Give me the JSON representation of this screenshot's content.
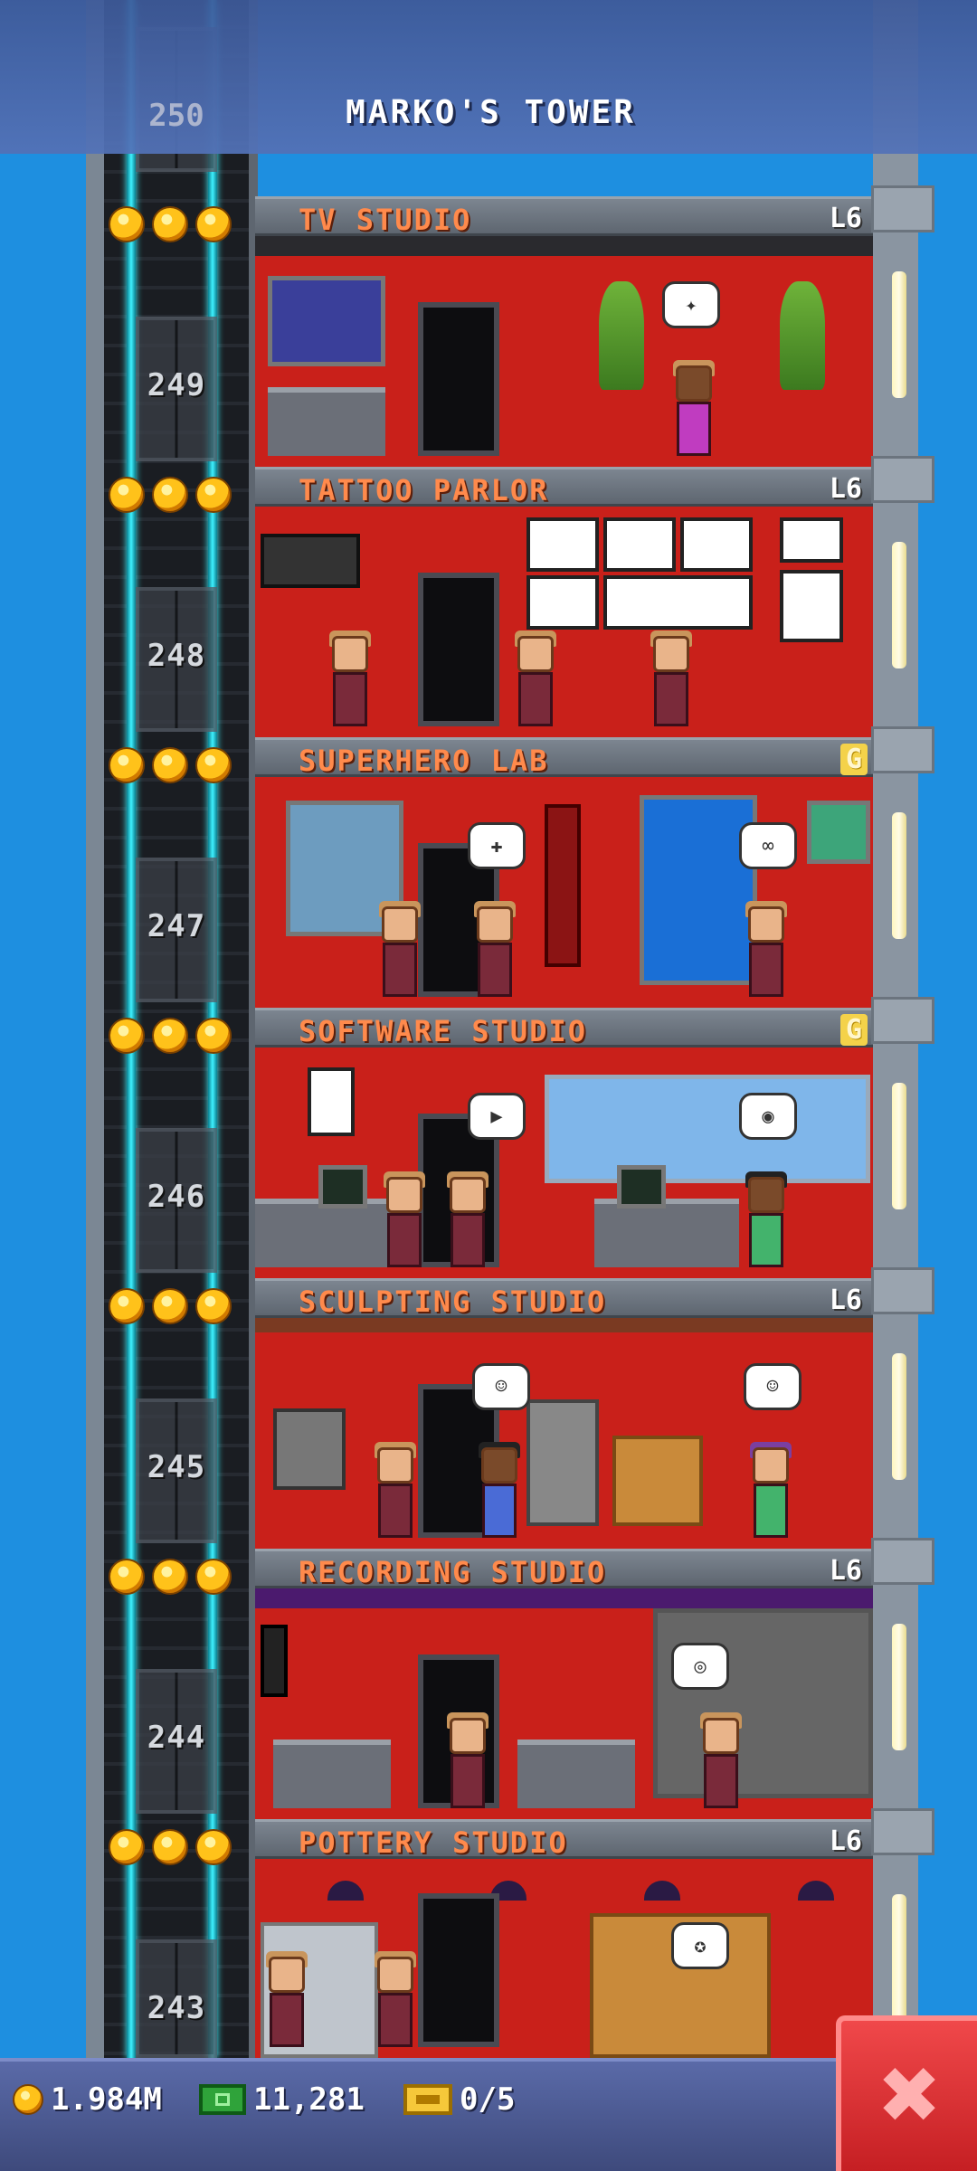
{
  "tower": {
    "title": "MARKO'S TOWER",
    "top_floor_number": "250"
  },
  "floors": [
    {
      "number": "249",
      "name": "TV STUDIO",
      "level": "L6",
      "gold": false,
      "stars": 3
    },
    {
      "number": "248",
      "name": "TATTOO PARLOR",
      "level": "L6",
      "gold": false,
      "stars": 3
    },
    {
      "number": "247",
      "name": "SUPERHERO LAB",
      "level": "G",
      "gold": true,
      "stars": 3
    },
    {
      "number": "246",
      "name": "SOFTWARE STUDIO",
      "level": "G",
      "gold": true,
      "stars": 3
    },
    {
      "number": "245",
      "name": "SCULPTING STUDIO",
      "level": "L6",
      "gold": false,
      "stars": 3
    },
    {
      "number": "244",
      "name": "RECORDING STUDIO",
      "level": "L6",
      "gold": false,
      "stars": 3
    },
    {
      "number": "243",
      "name": "POTTERY STUDIO",
      "level": "L6",
      "gold": false,
      "stars": 3
    }
  ],
  "resources": {
    "coins": "1.984M",
    "bux": "11,281",
    "tickets": "0/5"
  },
  "colors": {
    "sky": "#1e8fe0",
    "room": "#c9201a",
    "floor_label": "#ff8a4c",
    "cable": "#3ff1ff",
    "close_button": "#e0383b"
  },
  "icons": {
    "coins": "coin-icon",
    "bux": "bux-icon",
    "tickets": "ticket-icon",
    "close": "close-icon",
    "rating": "star-icon"
  }
}
